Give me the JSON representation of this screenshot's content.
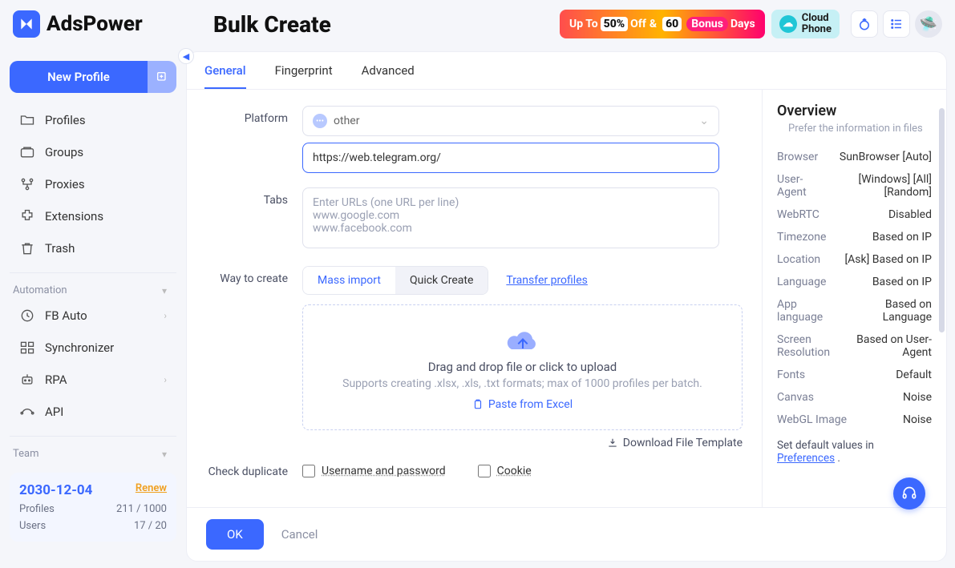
{
  "brand": "AdsPower",
  "page_title": "Bulk Create",
  "promo": {
    "prefix": "Up To",
    "pct": "50%",
    "off": "Off",
    "amp": "&",
    "days": "60",
    "bonus": "Bonus",
    "suffix": "Days"
  },
  "cloud_badge": "Cloud\nPhone",
  "sidebar": {
    "new_profile": "New Profile",
    "items": [
      {
        "label": "Profiles"
      },
      {
        "label": "Groups"
      },
      {
        "label": "Proxies"
      },
      {
        "label": "Extensions"
      },
      {
        "label": "Trash"
      }
    ],
    "automation_label": "Automation",
    "automation": [
      {
        "label": "FB Auto"
      },
      {
        "label": "Synchronizer"
      },
      {
        "label": "RPA"
      },
      {
        "label": "API"
      }
    ],
    "team_label": "Team",
    "license": {
      "date": "2030-12-04",
      "renew": "Renew",
      "profiles_label": "Profiles",
      "profiles_value": "211 / 1000",
      "users_label": "Users",
      "users_value": "17 / 20"
    }
  },
  "tabs": {
    "general": "General",
    "fingerprint": "Fingerprint",
    "advanced": "Advanced"
  },
  "form": {
    "platform_label": "Platform",
    "platform_value": "other",
    "platform_url": "https://web.telegram.org/",
    "tabs_label": "Tabs",
    "tabs_placeholder": "Enter URLs (one URL per line)\nwww.google.com\nwww.facebook.com",
    "way_label": "Way to create",
    "mass_import": "Mass import",
    "quick_create": "Quick Create",
    "transfer": "Transfer profiles",
    "drop_primary": "Drag and drop file or click to upload",
    "drop_sub": "Supports creating .xlsx, .xls, .txt formats; max of 1000 profiles per batch.",
    "paste": "Paste from Excel",
    "download_template": "Download File Template",
    "check_label": "Check duplicate",
    "chk_userpass": "Username and password",
    "chk_cookie": "Cookie"
  },
  "footer": {
    "ok": "OK",
    "cancel": "Cancel"
  },
  "overview": {
    "title": "Overview",
    "hint": "Prefer the information in files",
    "rows": [
      {
        "k": "Browser",
        "v": "SunBrowser [Auto]"
      },
      {
        "k": "User-Agent",
        "v": "[Windows] [All] [Random]"
      },
      {
        "k": "WebRTC",
        "v": "Disabled"
      },
      {
        "k": "Timezone",
        "v": "Based on IP"
      },
      {
        "k": "Location",
        "v": "[Ask] Based on IP"
      },
      {
        "k": "Language",
        "v": "Based on IP"
      },
      {
        "k": "App language",
        "v": "Based on Language"
      },
      {
        "k": "Screen Resolution",
        "v": "Based on User-Agent"
      },
      {
        "k": "Fonts",
        "v": "Default"
      },
      {
        "k": "Canvas",
        "v": "Noise"
      },
      {
        "k": "WebGL Image",
        "v": "Noise"
      }
    ],
    "foot_prefix": "Set default values in ",
    "foot_link": "Preferences",
    "foot_suffix": " ."
  }
}
